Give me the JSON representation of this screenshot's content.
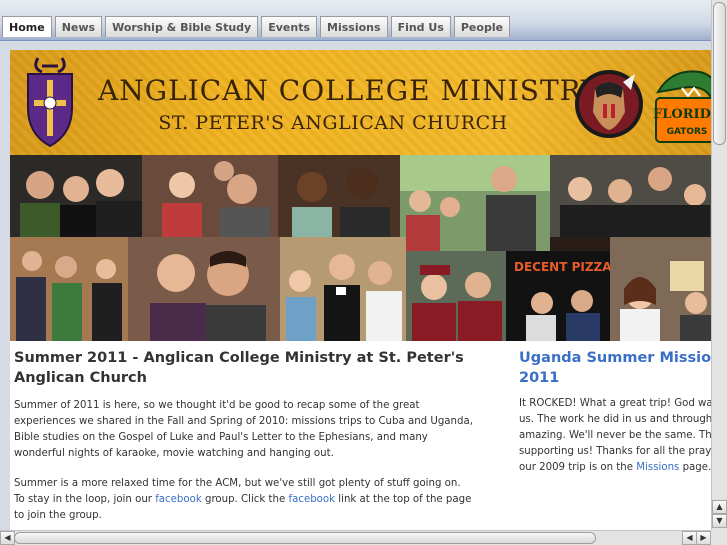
{
  "nav": {
    "tabs": [
      "Home",
      "News",
      "Worship & Bible Study",
      "Events",
      "Missions",
      "Find Us",
      "People"
    ],
    "active": "Home"
  },
  "banner": {
    "title": "ANGLICAN COLLEGE MINISTRY",
    "subtitle": "ST. PETER'S ANGLICAN CHURCH",
    "logo_right_text": "FLORIDA GATORS",
    "colors": {
      "banner": "#f0b21f",
      "text": "#3a2408"
    }
  },
  "main": {
    "title": "Summer 2011 - Anglican College Ministry at St. Peter's Anglican Church",
    "p1": "Summer of 2011 is here, so we thought it'd be good to recap some of the great experiences we shared in the Fall and Spring of 2010: missions trips to Cuba and Uganda, Bible studies on the Gospel of Luke and Paul's Letter to the Ephesians, and many wonderful nights of karaoke, movie watching and hanging out.",
    "p2_a": "Summer is a more relaxed time for the ACM, but we've still got plenty of stuff going on. To stay in the loop, join our ",
    "p2_link1": "facebook",
    "p2_b": " group. Click the ",
    "p2_link2": "facebook",
    "p2_c": " link at the top of the page to join the group."
  },
  "side": {
    "title_line1": "Uganda Summer Mission -",
    "title_line2": "2011",
    "lines": [
      "It ROCKED! What a great trip! God wa",
      "us. The work he did in us and through",
      "amazing. We'll never be the same. Th",
      "supporting us! Thanks for all the praye"
    ],
    "last_a": "our 2009 trip is on the ",
    "last_link": "Missions",
    "last_b": " page."
  },
  "colors": {
    "link": "#3b6fc7",
    "heading": "#333333"
  }
}
